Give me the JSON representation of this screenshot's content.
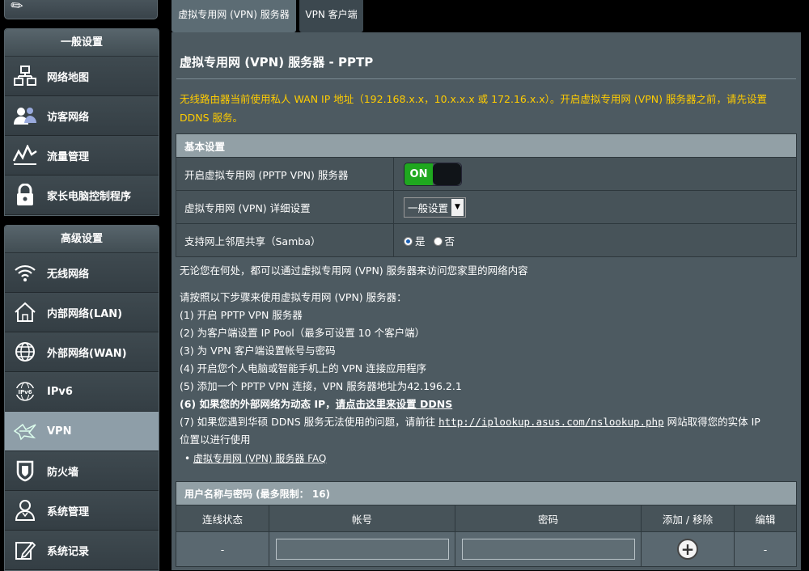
{
  "sidebar": {
    "general_title": "一般设置",
    "general_items": [
      {
        "label": "网络地图",
        "icon": "network-map-icon"
      },
      {
        "label": "访客网络",
        "icon": "guest-network-icon"
      },
      {
        "label": "流量管理",
        "icon": "traffic-manager-icon"
      },
      {
        "label": "家长电脑控制程序",
        "icon": "parental-control-icon"
      }
    ],
    "advanced_title": "高级设置",
    "advanced_items": [
      {
        "label": "无线网络",
        "icon": "wireless-icon"
      },
      {
        "label": "内部网络(LAN)",
        "icon": "lan-icon"
      },
      {
        "label": "外部网络(WAN)",
        "icon": "wan-icon"
      },
      {
        "label": "IPv6",
        "icon": "ipv6-icon"
      },
      {
        "label": "VPN",
        "icon": "vpn-icon",
        "active": true
      },
      {
        "label": "防火墙",
        "icon": "firewall-icon"
      },
      {
        "label": "系统管理",
        "icon": "administration-icon"
      },
      {
        "label": "系统记录",
        "icon": "system-log-icon"
      }
    ]
  },
  "tabs": [
    "虚拟专用网 (VPN) 服务器",
    "VPN 客户端"
  ],
  "page": {
    "title": "虚拟专用网 (VPN) 服务器 - PPTP",
    "warning": "无线路由器当前使用私人 WAN IP 地址（192.168.x.x，10.x.x.x 或 172.16.x.x）。开启虚拟专用网 (VPN) 服务器之前，请先设置 DDNS 服务。"
  },
  "basic": {
    "section_title": "基本设置",
    "enable_label": "开启虚拟专用网 (PPTP VPN) 服务器",
    "toggle_on": "ON",
    "detail_label": "虚拟专用网 (VPN) 详细设置",
    "detail_value": "一般设置",
    "samba_label": "支持网上邻居共享（Samba）",
    "samba_yes": "是",
    "samba_no": "否"
  },
  "info": {
    "intro": "无论您在何处，都可以通过虚拟专用网 (VPN) 服务器来访问您家里的网络内容",
    "steps_title": "请按照以下步骤来使用虚拟专用网 (VPN) 服务器：",
    "step1": "(1) 开启 PPTP VPN 服务器",
    "step2": "(2) 为客户端设置 IP Pool（最多可设置 10 个客户端）",
    "step3": "(3) 为 VPN 客户端设置帐号与密码",
    "step4": "(4) 开启您个人电脑或智能手机上的 VPN 连接应用程序",
    "step5": "(5) 添加一个 PPTP VPN 连接，VPN 服务器地址为42.196.2.1",
    "step6_text": "(6) 如果您的外部网络为动态 IP，",
    "step6_link": "请点击这里来设置 DDNS",
    "step7_pre": "(7) 如果您遇到华硕 DDNS 服务无法使用的问题，请前往",
    "step7_link": "http://iplookup.asus.com/nslookup.php",
    "step7_post": "网站取得您的实体 IP",
    "step7_line2": "位置以进行使用",
    "faq_bullet": "•",
    "faq_link": "虚拟专用网 (VPN) 服务器 FAQ"
  },
  "users": {
    "title": "用户名称与密码 (最多限制： 16)",
    "columns": [
      "连线状态",
      "帐号",
      "密码",
      "添加 / 移除",
      "编辑"
    ],
    "row": {
      "status": "-",
      "edit": "-"
    }
  }
}
